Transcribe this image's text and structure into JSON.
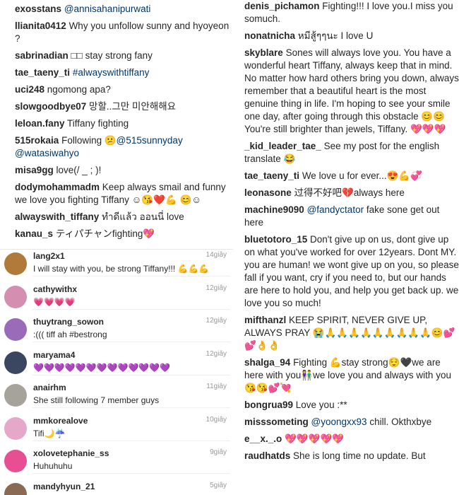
{
  "left_top_comments": [
    {
      "user": "exosstans",
      "text": "",
      "tag": "@annisahanipurwati"
    },
    {
      "user": "llianita0412",
      "text": " Why you unfollow sunny and hyoyeon ?",
      "tag": ""
    },
    {
      "user": "sabrinadian",
      "text": " □□ stay strong fany",
      "tag": ""
    },
    {
      "user": "tae_taeny_ti",
      "text": "",
      "tag": "#alwayswithtiffany"
    },
    {
      "user": "uci248",
      "text": " ngomong apa?",
      "tag": ""
    },
    {
      "user": "slowgoodbye07",
      "text": " 망할..그만 미안해해요",
      "tag": ""
    },
    {
      "user": "leloan.fany",
      "text": " Tiffany fighting",
      "tag": ""
    },
    {
      "user": "515rokaia",
      "text": " Following 😕",
      "tag": "@515sunnyday @watasiwahyo"
    },
    {
      "user": "misa9gg",
      "text": " love(/ _ ; )!",
      "tag": ""
    },
    {
      "user": "dodymohammadm",
      "text": " Keep always smail and funny we love you fighting Tiffany ☺😘❤️💪 😊☺",
      "tag": ""
    },
    {
      "user": "alwayswith_tiffany",
      "text": " ทำดีแล้ว ออนนี่ love",
      "tag": ""
    },
    {
      "user": "kanau_s",
      "text": " ティパチャンfighting💖",
      "tag": ""
    }
  ],
  "left_bottom_comments": [
    {
      "user": "lang2x1",
      "text": "I will stay with you, be strong Tiffany!!! 💪💪💪",
      "time": "14giây",
      "color": "#b07a3a"
    },
    {
      "user": "cathywithx",
      "text": "💗💗💗💗",
      "time": "12giây",
      "color": "#d48fb0"
    },
    {
      "user": "thuytrang_sowon",
      "text": ":((( tiff ah #bestrong",
      "time": "12giây",
      "color": "#9a6bb8"
    },
    {
      "user": "maryama4",
      "text": "💜💜💜💜💜💜💜💜💜💜💜💜💜",
      "time": "12giây",
      "color": "#3b4660"
    },
    {
      "user": "anairhm",
      "text": "She still following 7 member guys",
      "time": "11giây",
      "color": "#a6a39a"
    },
    {
      "user": "mmkorealove",
      "text": "Tifi🌙☔",
      "time": "10giây",
      "color": "#e6a8c8"
    },
    {
      "user": "xolovetephanie_ss",
      "text": "Huhuhuhu",
      "time": "9giây",
      "color": "#e84f92"
    },
    {
      "user": "mandyhyun_21",
      "text": "",
      "time": "5giây",
      "color": "#8b6a55"
    }
  ],
  "right_comments": [
    {
      "user": "denis_pichamon",
      "text": " Fighting!!! I love you.I miss you somuch.",
      "tag": ""
    },
    {
      "user": "nonatnicha",
      "text": " หมีสู้ๆๆนะ I love U",
      "tag": ""
    },
    {
      "user": "skyblare",
      "text": " Sones will always love you. You have a wonderful heart Tiffany, always keep that in mind. No matter how hard others bring you down, always remember that a beautiful heart is the most genuine thing in life. I'm hoping to see your smile one day, after going through this obstacle 😊😊You're still brighter than jewels, Tiffany. 💖💖💖",
      "tag": ""
    },
    {
      "user": "_kid_leader_tae_",
      "text": " See my post for the english translate 😂",
      "tag": ""
    },
    {
      "user": "tae_taeny_ti",
      "text": " We love u for ever...😍💪💞",
      "tag": ""
    },
    {
      "user": "leonasone",
      "text": " 过得不好吧💔always here",
      "tag": ""
    },
    {
      "user": "machine9090",
      "text": "",
      "tag": "@fandyctator",
      "after": " fake sone get out here"
    },
    {
      "user": "bluetotoro_15",
      "text": " Don't give up on us, dont give up on what you've worked for over 12years. Dont MY. you are human! we wont give up on you, so please fall if you want, cry if you need to, but our hands are here to hold you, and help you get back up. we love you so much!",
      "tag": ""
    },
    {
      "user": "mifthanzl",
      "text": " KEEP SPIRIT, NEVER GIVE UP, ALWAYS PRAY 😭🙏🙏🙏🙏🙏🙏🙏🙏🙏😊💕💕👌👌",
      "tag": ""
    },
    {
      "user": "shalga_94",
      "text": " Fighting 💪stay strong😌🖤we are here with you👫we love you and always with you😘😘💕💘",
      "tag": ""
    },
    {
      "user": "bongrua99",
      "text": " Love you :**",
      "tag": ""
    },
    {
      "user": "misssometing",
      "text": "",
      "tag": "@yoongxx93",
      "after": " chill. Okthxbye"
    },
    {
      "user": "e__x._.o",
      "text": " 💖💖💖💖💖",
      "tag": ""
    },
    {
      "user": "raudhatds",
      "text": " She is long time no update. But",
      "tag": ""
    }
  ]
}
